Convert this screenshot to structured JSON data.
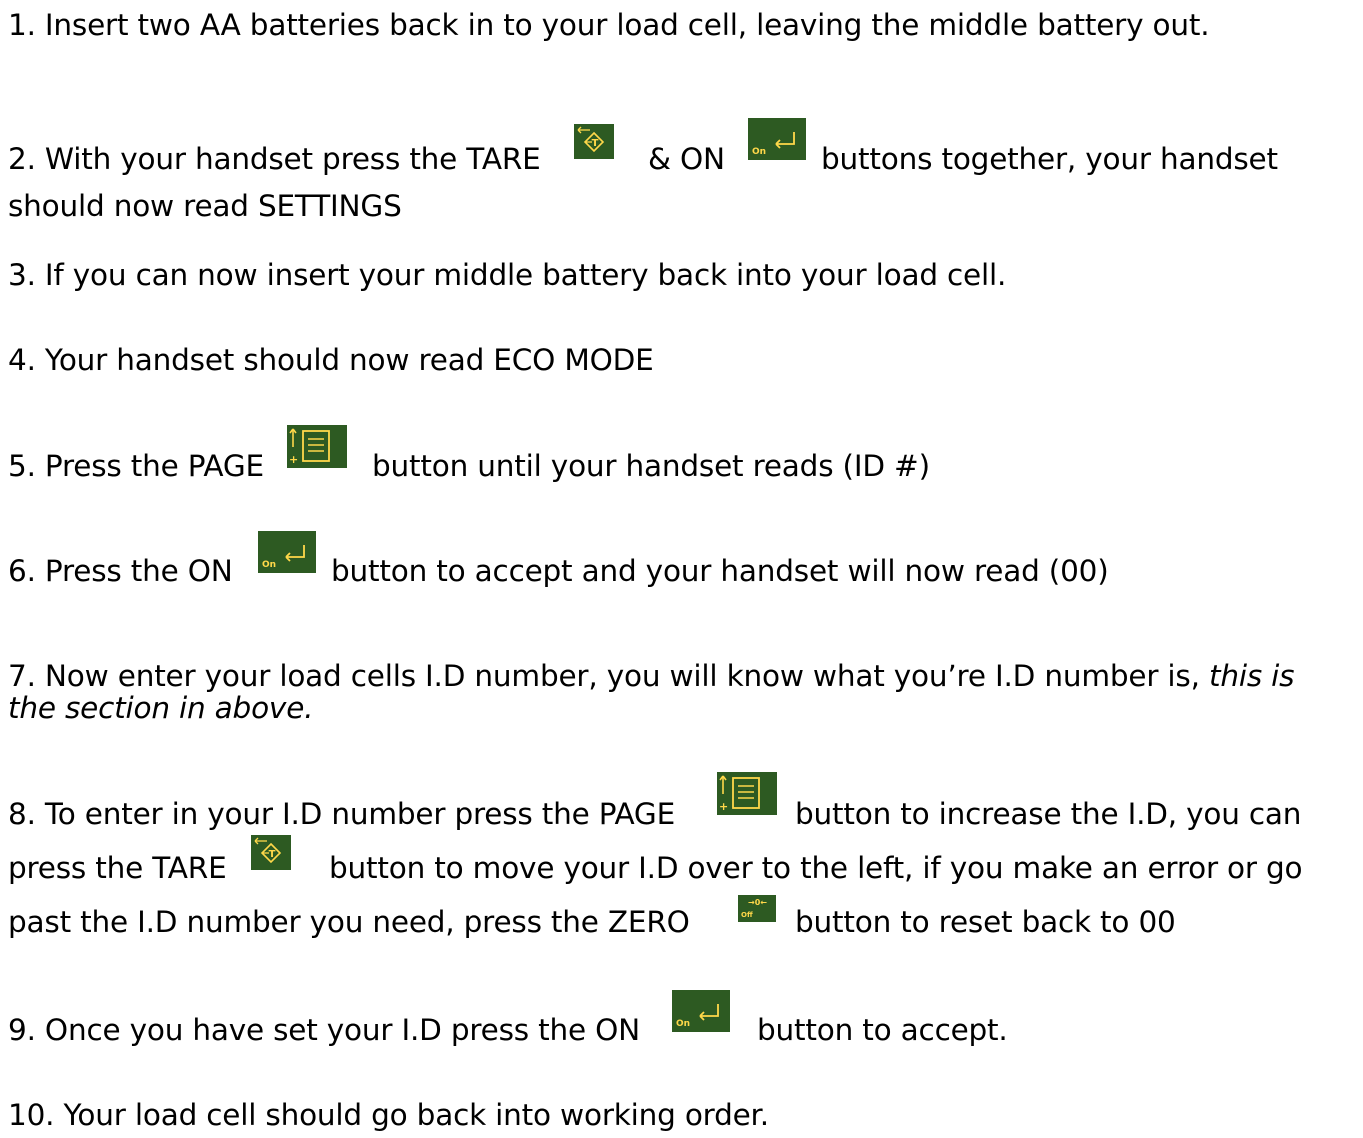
{
  "steps": [
    {
      "text": "1. Insert two AA batteries back in to your load cell, leaving the middle battery out."
    },
    {
      "a": "2. With your handset press the TARE",
      "b": "& ON",
      "c": "buttons together, your handset",
      "d": "should now read SETTINGS"
    },
    {
      "text": "3. If you can now insert your middle battery back into your load cell."
    },
    {
      "text": "4. Your handset should now read ECO MODE"
    },
    {
      "a": "5. Press the PAGE",
      "b": "button until your handset reads (ID #)"
    },
    {
      "a": "6. Press the ON",
      "b": "button to accept and your handset will now read (00)"
    },
    {
      "a": "7. Now enter your load cells I.D number, you will know what you’re I.D number is,",
      "italic1": "this is",
      "italic2": "the section in above."
    },
    {
      "a": "8. To enter in your I.D number press the PAGE",
      "b": "button to increase the I.D, you can",
      "c": "press the TARE",
      "d": "button to move your I.D over to the left, if you make an error or go",
      "e": "past the I.D number you need, press the ZERO",
      "f": "button to reset back to 00"
    },
    {
      "a": "9. Once you have set your I.D press the ON",
      "b": "button to accept."
    },
    {
      "text": "10. Your load cell should go back into working order."
    }
  ],
  "icons": {
    "on_label": "On",
    "off_label": "Off",
    "zero_glyph": "→0←",
    "plus_glyph": "+",
    "button_color": "#2d5a22",
    "glyph_color": "#ffd84a"
  }
}
